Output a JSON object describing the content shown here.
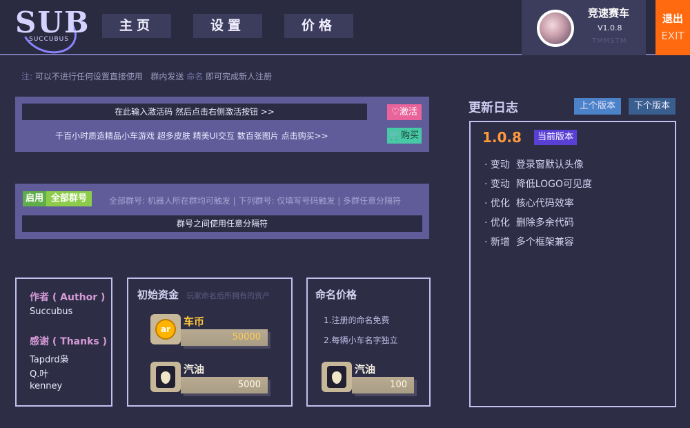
{
  "logo": {
    "big": "SUB",
    "small": "SUCCUBUS"
  },
  "nav": {
    "home": "主页",
    "settings": "设置",
    "price": "价格"
  },
  "user": {
    "game_title": "竞速赛车",
    "version": "V1.0.8",
    "blurred": "TMMSTM"
  },
  "exit": {
    "cn": "退出",
    "en": "EXIT"
  },
  "notice": {
    "prefix": "注:",
    "text1": "可以不进行任何设置直接使用",
    "text2": "群内发送",
    "keyword": "命名",
    "text3": "即可完成新人注册"
  },
  "activation": {
    "input_text": "在此输入激活码      然后点击右侧激活按钮  >>",
    "activate_label": "激活",
    "promo_text": "千百小时质造精品小车游戏  超多皮肤  精美UI交互  数百张图片    点击购买>>",
    "buy_label": "购买"
  },
  "groups": {
    "enable_label": "启用",
    "all_groups_label": "全部群号",
    "hint": "全部群号: 机器人所在群均可触发 | 下列群号: 仅填写号码触发 | 多群任意分隔符",
    "input_text": "群号之间使用任意分隔符"
  },
  "author": {
    "author_label": "作者 ( Author )",
    "author_name": "Succubus",
    "thanks_label": "感谢 ( Thanks )",
    "thanks": [
      "Tapdrd枭",
      "Q.叶",
      "kenney"
    ]
  },
  "funds": {
    "title": "初始资金",
    "subtitle": "玩家命名后所拥有的资产",
    "coin_label": "车币",
    "coin_icon_text": "ar",
    "coin_value": "50000",
    "fuel_label": "汽油",
    "fuel_value": "5000"
  },
  "naming": {
    "title": "命名价格",
    "rule1": "1.注册的命名免费",
    "rule2": "2.每辆小车名字独立",
    "fuel_label": "汽油",
    "fuel_value": "100"
  },
  "changelog": {
    "title": "更新日志",
    "prev_label": "上个版本",
    "next_label": "下个版本",
    "version": "1.0.8",
    "current_label": "当前版本",
    "items": [
      {
        "type": "· 变动",
        "text": "登录窗默认头像"
      },
      {
        "type": "· 变动",
        "text": "降低LOGO可见度"
      },
      {
        "type": "· 优化",
        "text": "核心代码效率"
      },
      {
        "type": "· 优化",
        "text": "删除多余代码"
      },
      {
        "type": "· 新增",
        "text": "多个框架兼容"
      }
    ]
  },
  "colors": {
    "accent": "#605c9a",
    "exit": "#ff6a10",
    "version": "#ff9a3c",
    "current_badge": "#5a3fd4",
    "pink_button": "#e85a8f",
    "green_button": "#3cc9a0"
  }
}
